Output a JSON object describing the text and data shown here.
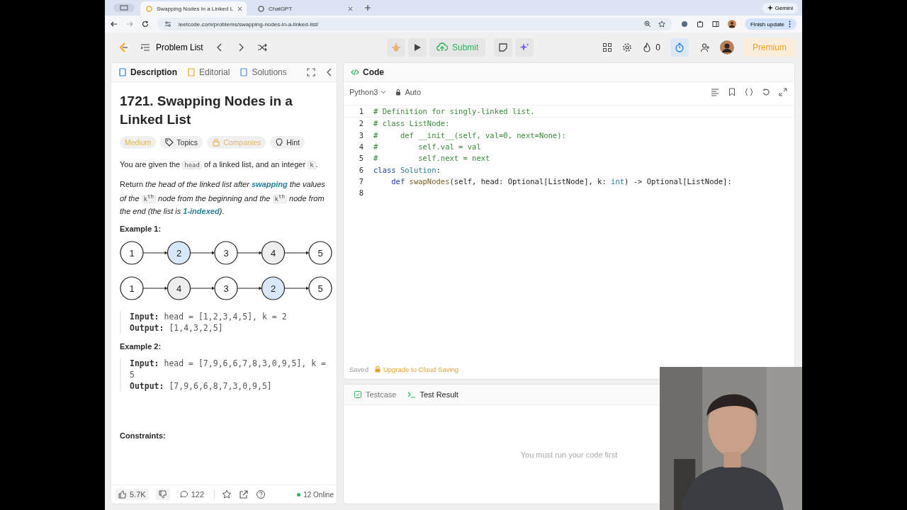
{
  "browser": {
    "tabs": [
      {
        "title": "Swapping Nodes in a Linked L",
        "selected": true
      },
      {
        "title": "ChatGPT",
        "selected": false
      }
    ],
    "gemini": "Gemini",
    "url": "leetcode.com/problems/swapping-nodes-in-a-linked-list/",
    "update_button": "Finish update"
  },
  "nav": {
    "problem_list": "Problem List",
    "submit": "Submit",
    "streak": "0",
    "premium": "Premium"
  },
  "left_tabs": [
    {
      "label": "Description",
      "selected": true
    },
    {
      "label": "Editorial",
      "selected": false
    },
    {
      "label": "Solutions",
      "selected": false
    }
  ],
  "problem": {
    "title": "1721. Swapping Nodes in a Linked List",
    "tags": [
      {
        "label": "Medium",
        "kind": "difficulty"
      },
      {
        "label": "Topics",
        "kind": "topics"
      },
      {
        "label": "Companies",
        "kind": "locked"
      },
      {
        "label": "Hint",
        "kind": "hint"
      }
    ],
    "paragraphs": [
      [
        {
          "text": "You are given the ",
          "kind": "plain"
        },
        {
          "text": "head",
          "kind": "code"
        },
        {
          "text": " of a linked list, and an integer ",
          "kind": "plain"
        },
        {
          "text": "k",
          "kind": "code"
        },
        {
          "text": ".",
          "kind": "plain"
        }
      ],
      [
        {
          "text": "Return ",
          "kind": "plain"
        },
        {
          "text": "the head of the linked list after ",
          "kind": "italic"
        },
        {
          "text": "swapping",
          "kind": "bolditalic"
        },
        {
          "text": " the values of the ",
          "kind": "italic"
        },
        {
          "text": "k$^{th}$",
          "kind": "code"
        },
        {
          "text": " node from the beginning and the ",
          "kind": "italic"
        },
        {
          "text": "k$^{th}$",
          "kind": "code"
        },
        {
          "text": " node from the end (the list is ",
          "kind": "italic"
        },
        {
          "text": "1-indexed",
          "kind": "bolditalic"
        },
        {
          "text": ")",
          "kind": "italic"
        },
        {
          "text": ".",
          "kind": "plain"
        }
      ]
    ],
    "examples": [
      {
        "title": "Example 1:",
        "lists": [
          [
            {
              "label": "1",
              "color": "#ffffff"
            },
            {
              "label": "2",
              "color": "#d9e8f8"
            },
            {
              "label": "3",
              "color": "#ffffff"
            },
            {
              "label": "4",
              "color": "#eeeeee"
            },
            {
              "label": "5",
              "color": "#ffffff"
            }
          ],
          [
            {
              "label": "1",
              "color": "#ffffff"
            },
            {
              "label": "4",
              "color": "#eeeeee"
            },
            {
              "label": "3",
              "color": "#ffffff"
            },
            {
              "label": "2",
              "color": "#d9e8f8"
            },
            {
              "label": "5",
              "color": "#ffffff"
            }
          ]
        ],
        "input_label": "Input:",
        "input": "head = [1,2,3,4,5], k = 2",
        "output_label": "Output:",
        "output": "[1,4,3,2,5]"
      },
      {
        "title": "Example 2:",
        "input_label": "Input:",
        "input": "head = [7,9,6,6,7,8,3,0,9,5], k = 5",
        "output_label": "Output:",
        "output": "[7,9,6,6,8,7,3,0,9,5]"
      }
    ],
    "constraints_title": "Constraints:"
  },
  "footer": {
    "likes": "5.7K",
    "comments": "122",
    "online": "12 Online"
  },
  "code_panel": {
    "title": "Code",
    "language": "Python3",
    "mode": "Auto",
    "lines": [
      {
        "number": "1",
        "tokens": [
          {
            "text": "# Definition for singly-linked list.",
            "kind": "comment"
          }
        ]
      },
      {
        "number": "2",
        "tokens": [
          {
            "text": "# class ListNode:",
            "kind": "comment"
          }
        ]
      },
      {
        "number": "3",
        "tokens": [
          {
            "text": "#     def __init__(self, val=0, next=None):",
            "kind": "comment"
          }
        ]
      },
      {
        "number": "4",
        "tokens": [
          {
            "text": "#         self.val = val",
            "kind": "comment"
          }
        ]
      },
      {
        "number": "5",
        "tokens": [
          {
            "text": "#         self.next = next",
            "kind": "comment"
          }
        ]
      },
      {
        "number": "6",
        "tokens": [
          {
            "text": "class ",
            "kind": "keyword"
          },
          {
            "text": "Solution",
            "kind": "class"
          },
          {
            "text": ":",
            "kind": "text"
          }
        ]
      },
      {
        "number": "7",
        "tokens": [
          {
            "text": "    def ",
            "kind": "keyword"
          },
          {
            "text": "swapNodes",
            "kind": "func"
          },
          {
            "text": "(self, head: Optional[ListNode], k: ",
            "kind": "text"
          },
          {
            "text": "int",
            "kind": "builtin"
          },
          {
            "text": ") -> Optional[ListNode]:",
            "kind": "text"
          }
        ]
      },
      {
        "number": "8"
      }
    ],
    "saved": "Saved",
    "upgrade": "Upgrade to Cloud Saving"
  },
  "test_panel": {
    "tabs": [
      {
        "label": "Testcase",
        "selected": false
      },
      {
        "label": "Test Result",
        "selected": true
      }
    ],
    "message": "You must run your code first"
  }
}
